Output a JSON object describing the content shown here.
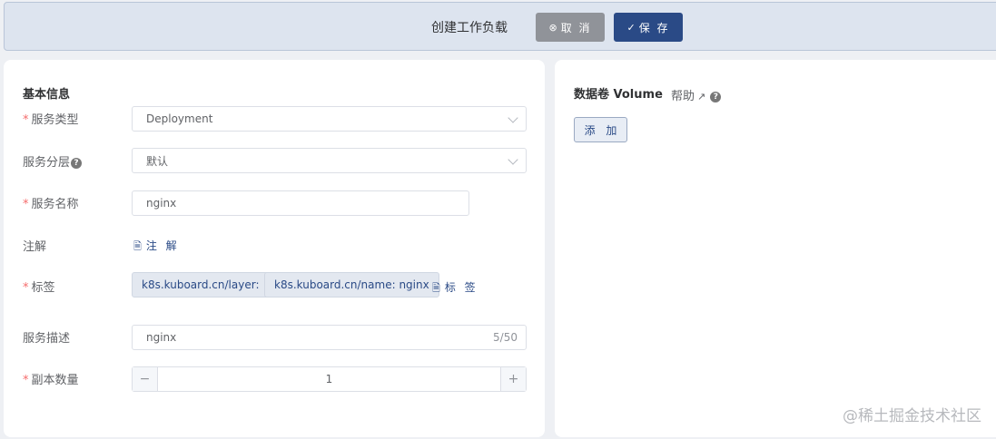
{
  "toolbar": {
    "title": "创建工作负载",
    "cancel_label": "取 消",
    "save_label": "保 存"
  },
  "basic": {
    "section_title": "基本信息",
    "service_type": {
      "label": "服务类型",
      "value": "Deployment"
    },
    "service_layer": {
      "label": "服务分层",
      "value": "默认"
    },
    "service_name": {
      "label": "服务名称",
      "value": "nginx"
    },
    "annotations": {
      "label": "注解",
      "button": "注 解"
    },
    "labels": {
      "label": "标签",
      "tags": [
        "k8s.kuboard.cn/layer:",
        "k8s.kuboard.cn/name: nginx"
      ],
      "button": "标 签"
    },
    "description": {
      "label": "服务描述",
      "value": "nginx",
      "counter": "5/50"
    },
    "replicas": {
      "label": "副本数量",
      "value": "1"
    }
  },
  "volume": {
    "title": "数据卷 Volume",
    "help": "帮助",
    "add_label": "添 加"
  },
  "watermark": "@稀土掘金技术社区",
  "icons": {
    "cancel": "circle-x-icon",
    "save": "circle-check-icon",
    "doc": "document-icon",
    "external": "external-link-icon",
    "help": "question-circle-icon"
  },
  "colors": {
    "primary": "#2a4a86",
    "required": "#f56c6c",
    "cancel": "#909399"
  }
}
